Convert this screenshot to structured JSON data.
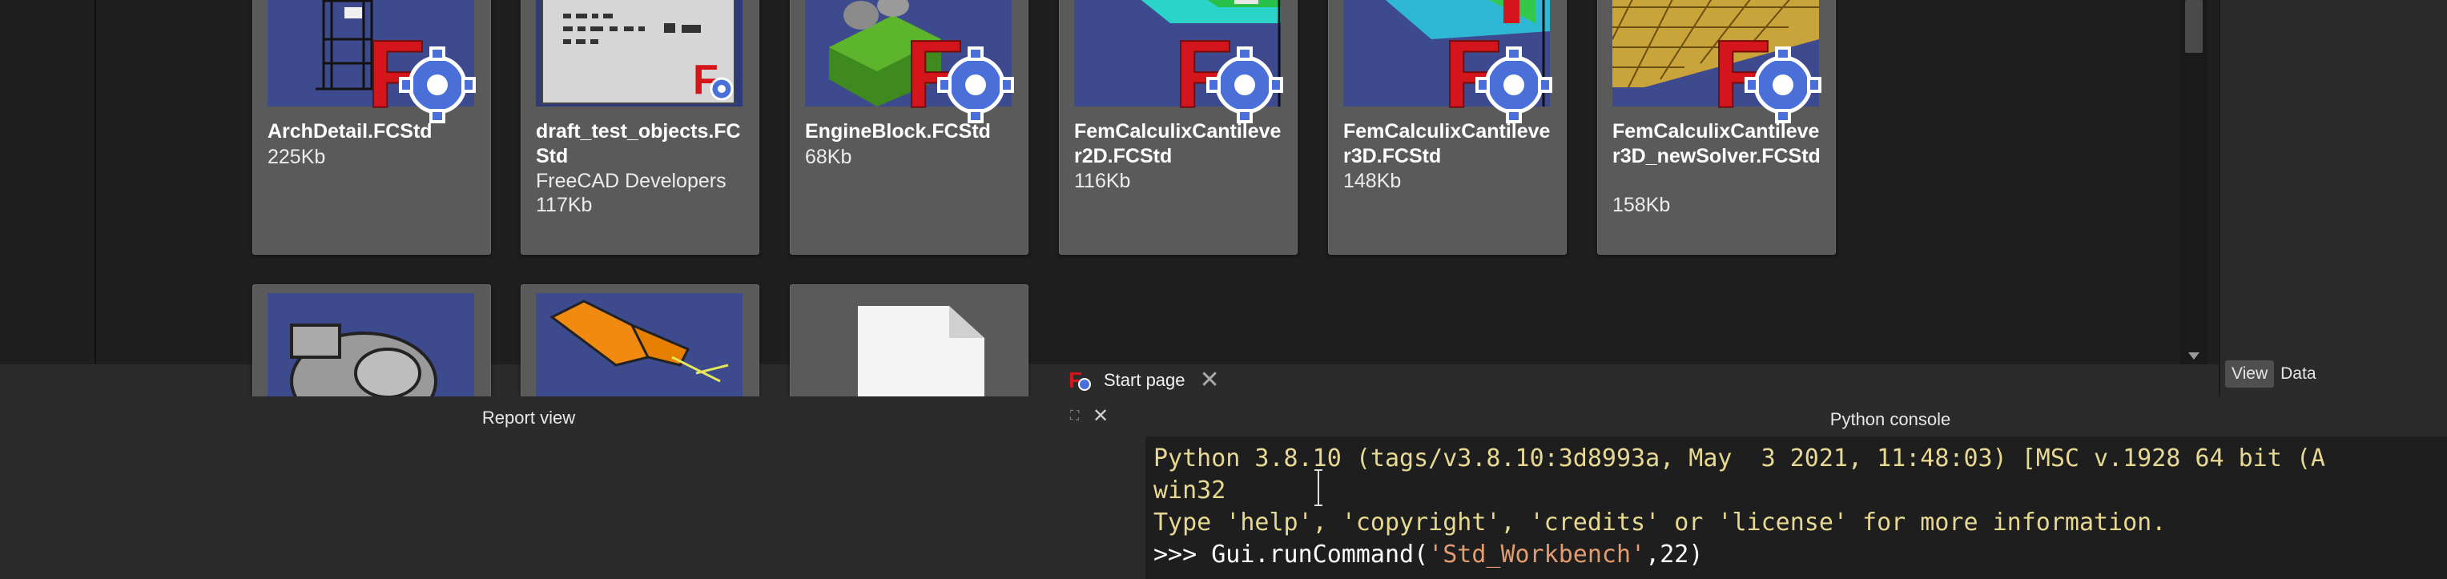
{
  "start_page": {
    "cards_row1": [
      {
        "title": "ArchDetail.FCStd",
        "author": "",
        "size": "225Kb",
        "thumb": "arch-detail-thumbnail"
      },
      {
        "title": "draft_test_objects.FCStd",
        "author": "FreeCAD Developers",
        "size": "117Kb",
        "thumb": "draft-test-thumbnail"
      },
      {
        "title": "EngineBlock.FCStd",
        "author": "",
        "size": "68Kb",
        "thumb": "engine-block-thumbnail"
      },
      {
        "title": "FemCalculixCantilever2D.FCStd",
        "author": "",
        "size": "116Kb",
        "thumb": "fem-cantilever-2d-thumbnail"
      },
      {
        "title": "FemCalculixCantilever3D.FCStd",
        "author": "",
        "size": "148Kb",
        "thumb": "fem-cantilever-3d-thumbnail"
      },
      {
        "title": "FemCalculixCantilever3D_newSolver.FCStd",
        "author": "",
        "size": "158Kb",
        "thumb": "fem-cantilever-3d-new-solver-thumbnail"
      }
    ],
    "cards_row2": [
      {
        "thumb": "gear-part-thumbnail"
      },
      {
        "thumb": "robot-arm-thumbnail"
      },
      {
        "thumb": "blank-document-thumbnail"
      }
    ]
  },
  "tabs": {
    "start_page_label": "Start page",
    "close_symbol": "✕"
  },
  "property_view": {
    "tab_view": "View",
    "tab_data": "Data"
  },
  "report_view": {
    "title": "Report view"
  },
  "python_console": {
    "title": "Python console",
    "float_symbol": "⛶",
    "close_symbol": "✕",
    "line1": "Python 3.8.10 (tags/v3.8.10:3d8993a, May  3 2021, 11:48:03) [MSC v.1928 64 bit (A",
    "line2": "win32",
    "line3": "Type 'help', 'copyright', 'credits' or 'license' for more information.",
    "line4_prompt": ">>> ",
    "line4_code_a": "Gui.runCommand(",
    "line4_string": "'Std_Workbench'",
    "line4_code_b": ",",
    "line4_number": "22",
    "line4_code_c": ")"
  },
  "colors": {
    "freecad_red": "#d4161c",
    "gear_blue": "#4a6fd8",
    "console_info": "#e7d892",
    "console_string": "#e39c6f"
  }
}
